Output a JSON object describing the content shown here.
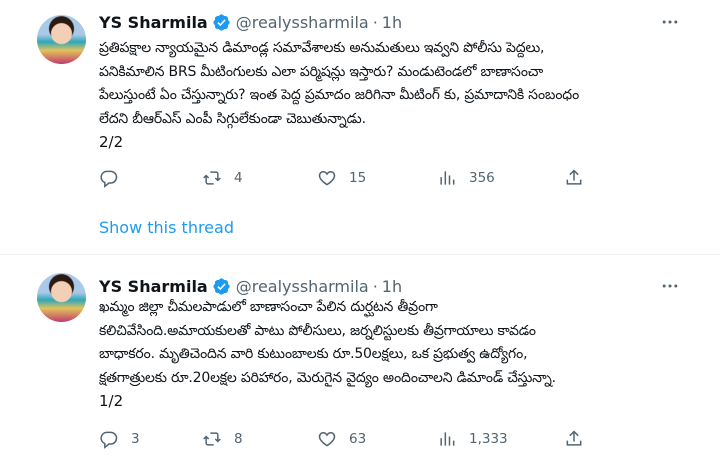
{
  "tweets": [
    {
      "author_name": "YS Sharmila",
      "handle": "@realyssharmila",
      "separator": "·",
      "time": "1h",
      "lines": [
        "ప్రతిపక్షాల న్యాయమైన డిమాండ్ల సమావేశాలకు అనుమతులు ఇవ్వని పోలీసు పెద్దలు,",
        "పనికిమాలిన BRS మీటింగులకు ఎలా పర్మిషన్లు ఇస్తారు? మండుటెండలో బాణాసంచా",
        "పేలుస్తుంటే ఏం చేస్తున్నారు? ఇంత పెద్ద ప్రమాదం జరిగినా మీటింగ్ కు, ప్రమాదానికి సంబంధం",
        "లేదని బీఆర్ఎస్ ఎంపీ సిగ్గులేకుండా చెబుతున్నాడు.",
        "2/2"
      ],
      "replies": "",
      "retweets": "4",
      "likes": "15",
      "views": "356"
    },
    {
      "author_name": "YS Sharmila",
      "handle": "@realyssharmila",
      "separator": "·",
      "time": "1h",
      "lines": [
        "ఖమ్మం జిల్లా చీమలపాడులో బాణాసంచా పేలిన దుర్ఘటన తీవ్రంగా",
        "కలిచివేసింది.అమాయకులతో పాటు పోలీసులు, జర్నలిస్టులకు తీవ్రగాయాలు కావడం",
        "బాధాకరం. మృతిచెందిన వారి కుటుంబాలకు రూ.50లక్షలు, ఒక ప్రభుత్వ ఉద్యోగం,",
        "క్షతగాత్రులకు రూ.20లక్షల పరిహారం, మెరుగైన వైద్యం అందించాలని డిమాండ్ చేస్తున్నా.",
        "1/2"
      ],
      "replies": "3",
      "retweets": "8",
      "likes": "63",
      "views": "1,333"
    }
  ],
  "show_thread_label": "Show this thread",
  "colors": {
    "text": "#0f1419",
    "secondary": "#536471",
    "link": "#1d9bf0",
    "verified": "#1d9bf0",
    "divider": "#eff3f4"
  },
  "icons": [
    "verified-badge-icon",
    "more-icon",
    "reply-icon",
    "retweet-icon",
    "like-icon",
    "views-icon",
    "share-icon"
  ]
}
